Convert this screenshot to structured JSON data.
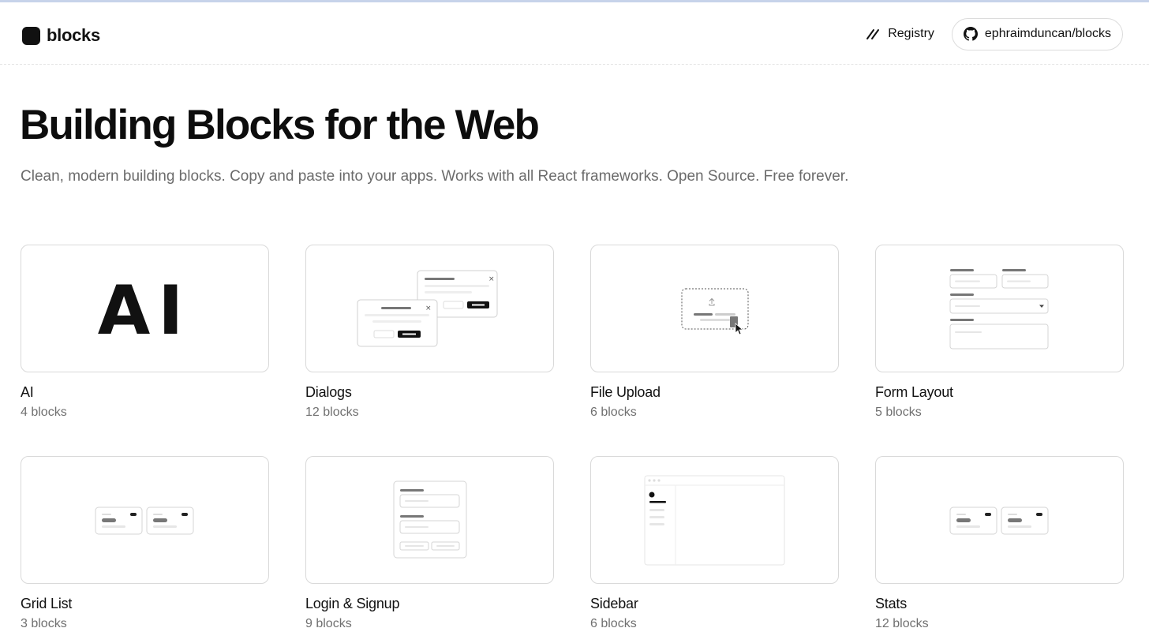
{
  "brand": {
    "name": "blocks"
  },
  "nav": {
    "registry_label": "Registry",
    "github_label": "ephraimduncan/blocks"
  },
  "hero": {
    "title": "Building Blocks for the Web",
    "subtitle": "Clean, modern building blocks. Copy and paste into your apps. Works with all React frameworks. Open Source. Free forever."
  },
  "thumb_text": {
    "ai": "AI"
  },
  "categories": [
    {
      "title": "AI",
      "count": "4 blocks",
      "icon": "ai-preview"
    },
    {
      "title": "Dialogs",
      "count": "12 blocks",
      "icon": "dialogs-preview"
    },
    {
      "title": "File Upload",
      "count": "6 blocks",
      "icon": "file-upload-preview"
    },
    {
      "title": "Form Layout",
      "count": "5 blocks",
      "icon": "form-layout-preview"
    },
    {
      "title": "Grid List",
      "count": "3 blocks",
      "icon": "grid-list-preview"
    },
    {
      "title": "Login & Signup",
      "count": "9 blocks",
      "icon": "login-signup-preview"
    },
    {
      "title": "Sidebar",
      "count": "6 blocks",
      "icon": "sidebar-preview"
    },
    {
      "title": "Stats",
      "count": "12 blocks",
      "icon": "stats-preview"
    }
  ]
}
